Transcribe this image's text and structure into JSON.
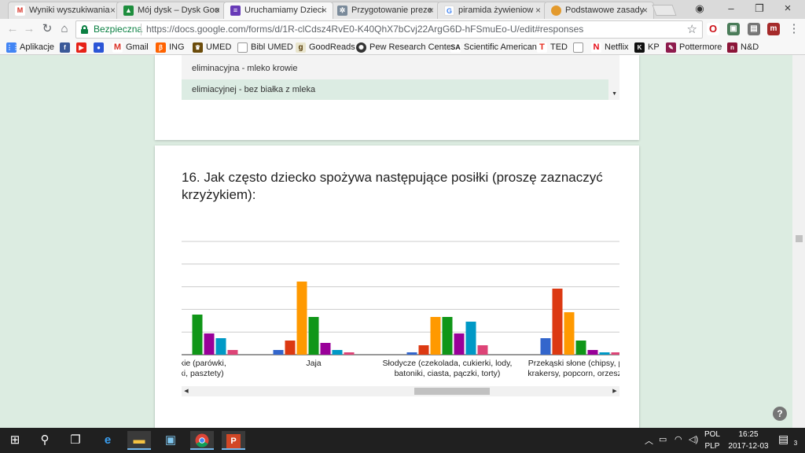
{
  "tabs": [
    {
      "title": "Wyniki wyszukiwania",
      "icon": "gmail-icon",
      "color": "#d93025"
    },
    {
      "title": "Mój dysk – Dysk Goo",
      "icon": "drive-icon",
      "color": "#1e8e3e"
    },
    {
      "title": "Uruchamiamy Dzieci",
      "icon": "forms-icon",
      "color": "#673ab7"
    },
    {
      "title": "Przygotowanie preze",
      "icon": "gear-icon",
      "color": "#7a8a9a"
    },
    {
      "title": "piramida żywieniow",
      "icon": "google-icon",
      "color": "#4285f4"
    },
    {
      "title": "Podstawowe zasady",
      "icon": "site-icon",
      "color": "#e39a2d"
    }
  ],
  "toolbar": {
    "secure_label": "Bezpieczna",
    "url": "https://docs.google.com/forms/d/1R-clCdsz4RvE0-K40QhX7bCvj22ArgG6D-hFSmuEo-U/edit#responses"
  },
  "bookmarks": [
    {
      "label": "Aplikacje",
      "icon": "apps-icon",
      "color": "#4285f4"
    },
    {
      "label": "",
      "icon": "facebook-icon",
      "color": "#3b5998"
    },
    {
      "label": "",
      "icon": "youtube-icon",
      "color": "#e62117"
    },
    {
      "label": "",
      "icon": "ovh-icon",
      "color": "#2b55d6"
    },
    {
      "label": "Gmail",
      "icon": "gmail-icon",
      "color": "#d93025"
    },
    {
      "label": "ING",
      "icon": "ing-icon",
      "color": "#ff6200"
    },
    {
      "label": "UMED",
      "icon": "umed-icon",
      "color": "#6b4b0a"
    },
    {
      "label": "Bibl UMED",
      "icon": "page-icon",
      "color": "#9e9e9e"
    },
    {
      "label": "GoodReads",
      "icon": "goodreads-icon",
      "color": "#b5892d"
    },
    {
      "label": "Pew Research Center",
      "icon": "pew-icon",
      "color": "#333333"
    },
    {
      "label": "Scientific American",
      "icon": "sa-icon",
      "color": "#222222"
    },
    {
      "label": "TED",
      "icon": "ted-icon",
      "color": "#e62b1e"
    },
    {
      "label": "",
      "icon": "page-icon",
      "color": "#9e9e9e"
    },
    {
      "label": "Netflix",
      "icon": "netflix-icon",
      "color": "#e50914"
    },
    {
      "label": "KP",
      "icon": "kp-icon",
      "color": "#111111"
    },
    {
      "label": "Pottermore",
      "icon": "pottermore-icon",
      "color": "#8e1b4d"
    },
    {
      "label": "N&D",
      "icon": "nd-icon",
      "color": "#8b1538"
    }
  ],
  "top_list": {
    "items": [
      "eliminacyjna - mleko krowie",
      "elimiacyjnej - bez białka z mleka"
    ]
  },
  "question": {
    "title": "16. Jak często dziecko spożywa następujące posiłki (proszę zaznaczyć krzyżykiem):"
  },
  "colors": {
    "series": [
      "#3366cc",
      "#dc3912",
      "#ff9900",
      "#109618",
      "#990099",
      "#0099c6",
      "#dd4477"
    ]
  },
  "chart_data": {
    "type": "bar",
    "categories": [
      {
        "lines": [
          "arskie (parówki,",
          "aski, pasztety)"
        ],
        "values": [
          0,
          0,
          0,
          17,
          9,
          7,
          2
        ]
      },
      {
        "lines": [
          "Jaja"
        ],
        "values": [
          2,
          6,
          31,
          16,
          5,
          2,
          1
        ]
      },
      {
        "lines": [
          "Słodycze (czekolada, cukierki, lody,",
          "batoniki, ciasta, pączki, torty)"
        ],
        "values": [
          1,
          4,
          16,
          16,
          9,
          14,
          4
        ]
      },
      {
        "lines": [
          "Przekąski słone (chipsy, palu",
          "krakersy, popcorn, orzeszki s"
        ],
        "values": [
          7,
          28,
          18,
          6,
          2,
          1,
          1
        ]
      }
    ],
    "ylim": [
      0,
      48
    ],
    "gridlines": 5,
    "grid": true
  },
  "taskbar": {
    "lang_top": "POL",
    "lang_bottom": "PLP",
    "time": "16:25",
    "date": "2017-12-03",
    "notification_count": "3"
  }
}
